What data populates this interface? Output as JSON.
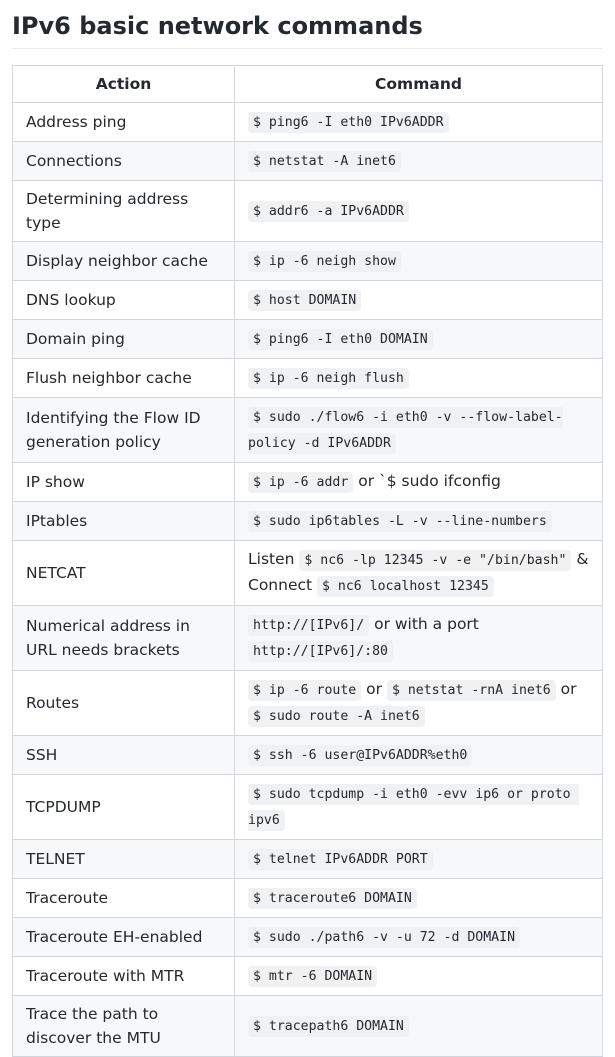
{
  "title": "IPv6 basic network commands",
  "table": {
    "headers": [
      "Action",
      "Command"
    ],
    "rows": [
      {
        "action": "Address ping",
        "parts": [
          {
            "code": "$ ping6 -I eth0 IPv6ADDR"
          }
        ]
      },
      {
        "action": "Connections",
        "parts": [
          {
            "code": "$ netstat -A inet6"
          }
        ]
      },
      {
        "action": "Determining address type",
        "parts": [
          {
            "code": "$ addr6 -a IPv6ADDR"
          }
        ]
      },
      {
        "action": "Display neighbor cache",
        "parts": [
          {
            "code": "$ ip -6 neigh show"
          }
        ]
      },
      {
        "action": "DNS lookup",
        "parts": [
          {
            "code": "$ host DOMAIN"
          }
        ]
      },
      {
        "action": "Domain ping",
        "parts": [
          {
            "code": "$ ping6 -I eth0 DOMAIN"
          }
        ]
      },
      {
        "action": "Flush neighbor cache",
        "parts": [
          {
            "code": "$ ip -6 neigh flush"
          }
        ]
      },
      {
        "action": "Identifying the Flow ID generation policy",
        "parts": [
          {
            "code": "$ sudo ./flow6 -i eth0 -v --flow-label-policy -d IPv6ADDR"
          }
        ]
      },
      {
        "action": "IP show",
        "parts": [
          {
            "code": "$ ip -6 addr"
          },
          {
            "text": " or `$ sudo ifconfig"
          }
        ]
      },
      {
        "action": "IPtables",
        "parts": [
          {
            "code": "$ sudo ip6tables -L -v --line-numbers"
          }
        ]
      },
      {
        "action": "NETCAT",
        "parts": [
          {
            "text": "Listen "
          },
          {
            "code": "$ nc6 -lp 12345 -v -e \"/bin/bash\""
          },
          {
            "text": " & Connect "
          },
          {
            "code": "$ nc6 localhost 12345"
          }
        ]
      },
      {
        "action": "Numerical address in URL needs brackets",
        "parts": [
          {
            "code": "http://[IPv6]/"
          },
          {
            "text": " or with a port "
          },
          {
            "code": "http://[IPv6]/:80"
          }
        ]
      },
      {
        "action": "Routes",
        "parts": [
          {
            "code": "$ ip -6 route"
          },
          {
            "text": " or "
          },
          {
            "code": "$ netstat -rnA inet6"
          },
          {
            "text": " or "
          },
          {
            "code": "$ sudo route -A inet6"
          }
        ]
      },
      {
        "action": "SSH",
        "parts": [
          {
            "code": "$ ssh -6 user@IPv6ADDR%eth0"
          }
        ]
      },
      {
        "action": "TCPDUMP",
        "parts": [
          {
            "code": "$ sudo tcpdump -i eth0 -evv ip6 or proto ipv6"
          }
        ]
      },
      {
        "action": "TELNET",
        "parts": [
          {
            "code": "$ telnet IPv6ADDR PORT"
          }
        ]
      },
      {
        "action": "Traceroute",
        "parts": [
          {
            "code": "$ traceroute6 DOMAIN"
          }
        ]
      },
      {
        "action": "Traceroute EH-enabled",
        "parts": [
          {
            "code": "$ sudo ./path6 -v -u 72 -d DOMAIN"
          }
        ]
      },
      {
        "action": "Traceroute with MTR",
        "parts": [
          {
            "code": "$ mtr -6 DOMAIN"
          }
        ]
      },
      {
        "action": "Trace the path to discover the MTU",
        "parts": [
          {
            "code": "$ tracepath6 DOMAIN"
          }
        ]
      }
    ]
  }
}
